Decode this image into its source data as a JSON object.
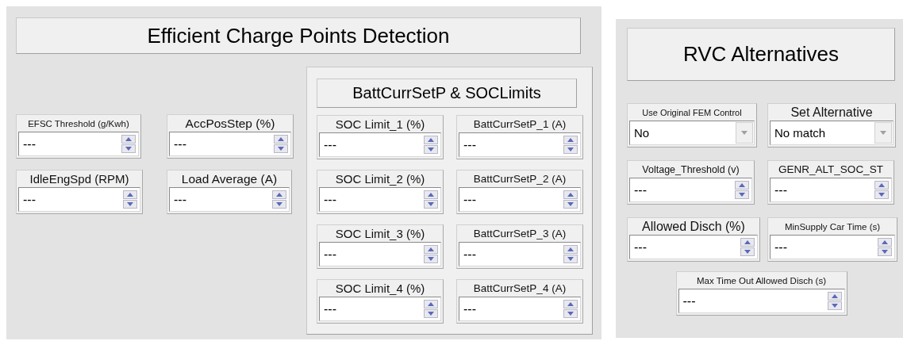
{
  "left_panel": {
    "title": "Efficient Charge Points Detection",
    "controls": [
      {
        "kind": "spinner",
        "label": "EFSC Threshold (g/Kwh)",
        "value": "---"
      },
      {
        "kind": "spinner",
        "label": "AccPosStep (%)",
        "value": "---"
      },
      {
        "kind": "spinner",
        "label": "IdleEngSpd (RPM)",
        "value": "---"
      },
      {
        "kind": "spinner",
        "label": "Load Average (A)",
        "value": "---"
      }
    ],
    "group": {
      "title": "BattCurrSetP &  SOCLimits",
      "controls": [
        {
          "kind": "spinner",
          "label": "SOC Limit_1 (%)",
          "value": "---"
        },
        {
          "kind": "spinner",
          "label": "BattCurrSetP_1 (A)",
          "value": "---"
        },
        {
          "kind": "spinner",
          "label": "SOC Limit_2 (%)",
          "value": "---"
        },
        {
          "kind": "spinner",
          "label": "BattCurrSetP_2 (A)",
          "value": "---"
        },
        {
          "kind": "spinner",
          "label": "SOC Limit_3 (%)",
          "value": "---"
        },
        {
          "kind": "spinner",
          "label": "BattCurrSetP_3 (A)",
          "value": "---"
        },
        {
          "kind": "spinner",
          "label": "SOC Limit_4 (%)",
          "value": "---"
        },
        {
          "kind": "spinner",
          "label": "BattCurrSetP_4 (A)",
          "value": "---"
        }
      ]
    }
  },
  "right_panel": {
    "title": "RVC Alternatives",
    "controls": [
      {
        "kind": "dropdown",
        "label": "Use Original FEM Control",
        "value": "No"
      },
      {
        "kind": "dropdown",
        "label": "Set Alternative",
        "value": "No match"
      },
      {
        "kind": "spinner",
        "label": "Voltage_Threshold (v)",
        "value": "---"
      },
      {
        "kind": "spinner",
        "label": "GENR_ALT_SOC_ST",
        "value": "---"
      },
      {
        "kind": "spinner",
        "label": "Allowed Disch (%)",
        "value": "---"
      },
      {
        "kind": "spinner",
        "label": "MinSupply Car Time (s)",
        "value": "---"
      },
      {
        "kind": "spinner",
        "label": "Max Time Out Allowed Disch (s)",
        "value": "---"
      }
    ]
  }
}
